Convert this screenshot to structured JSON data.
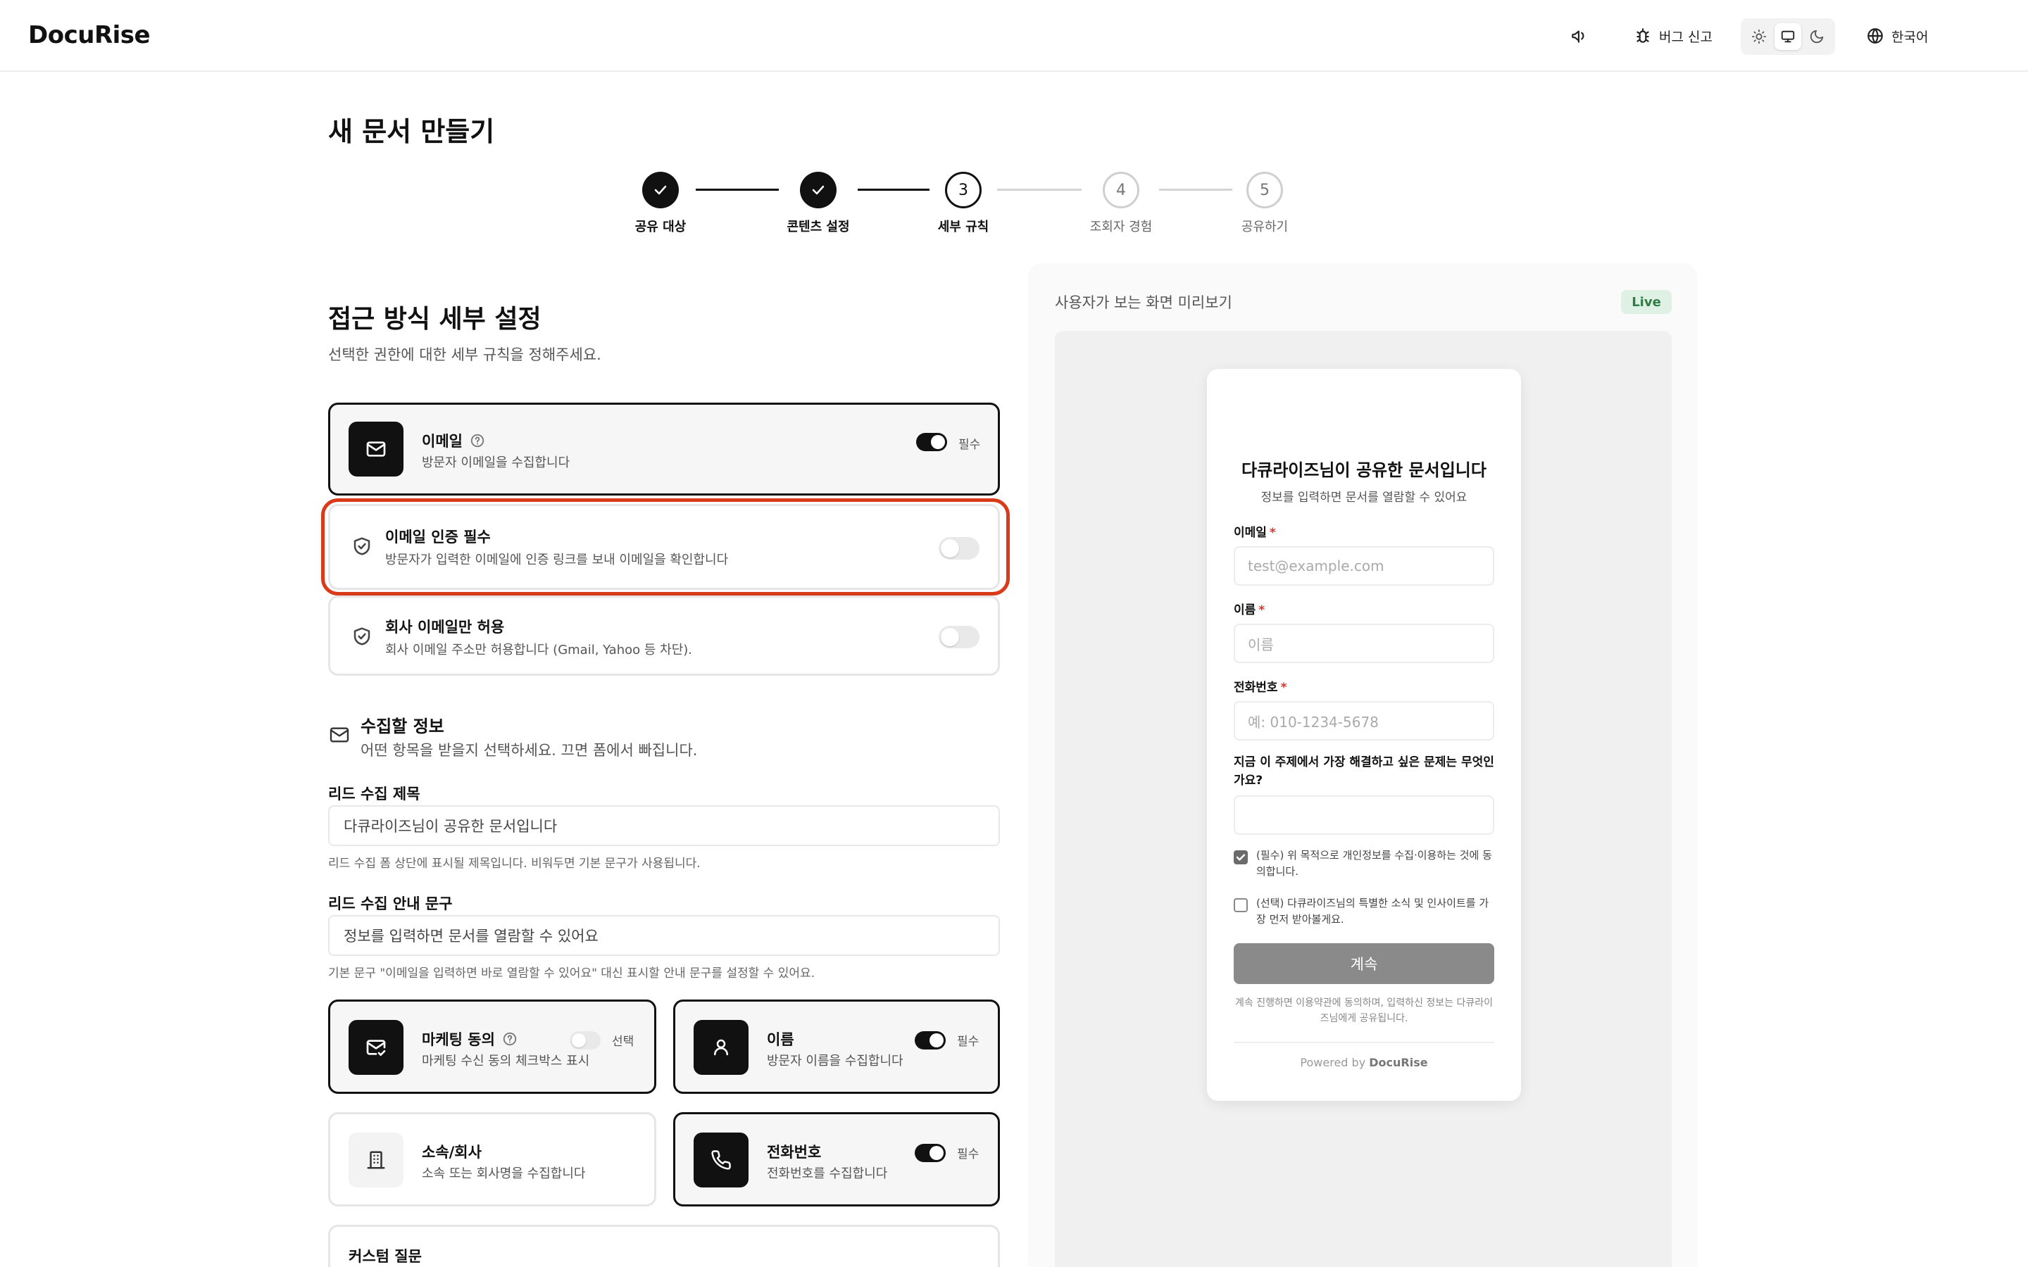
{
  "header": {
    "logo": "DocuRise",
    "bug_report_label": "버그 신고",
    "language_label": "한국어"
  },
  "page": {
    "title": "새 문서 만들기"
  },
  "stepper": {
    "steps": [
      {
        "number": "",
        "label": "공유 대상",
        "state": "done"
      },
      {
        "number": "",
        "label": "콘텐츠 설정",
        "state": "done"
      },
      {
        "number": "3",
        "label": "세부 규칙",
        "state": "current"
      },
      {
        "number": "4",
        "label": "조회자 경험",
        "state": "todo"
      },
      {
        "number": "5",
        "label": "공유하기",
        "state": "todo"
      }
    ]
  },
  "access": {
    "title": "접근 방식 세부 설정",
    "subtitle": "선택한 권한에 대한 세부 규칙을 정해주세요.",
    "email_card": {
      "title": "이메일",
      "desc": "방문자 이메일을 수집합니다",
      "toggle": true,
      "tag": "필수"
    },
    "email_verify": {
      "title": "이메일 인증 필수",
      "desc": "방문자가 입력한 이메일에 인증 링크를 보내 이메일을 확인합니다",
      "toggle": false
    },
    "company_only": {
      "title": "회사 이메일만 허용",
      "desc": "회사 이메일 주소만 허용합니다 (Gmail, Yahoo 등 차단).",
      "toggle": false
    }
  },
  "collect": {
    "title": "수집할 정보",
    "subtitle": "어떤 항목을 받을지 선택하세요. 끄면 폼에서 빠집니다.",
    "lead_title_label": "리드 수집 제목",
    "lead_title_value": "다큐라이즈님이 공유한 문서입니다",
    "lead_title_hint": "리드 수집 폼 상단에 표시될 제목입니다. 비워두면 기본 문구가 사용됩니다.",
    "lead_guide_label": "리드 수집 안내 문구",
    "lead_guide_value": "정보를 입력하면 문서를 열람할 수 있어요",
    "lead_guide_hint": "기본 문구 \"이메일을 입력하면 바로 열람할 수 있어요\" 대신 표시할 안내 문구를 설정할 수 있어요.",
    "fields": {
      "marketing": {
        "title": "마케팅 동의",
        "desc": "마케팅 수신 동의 체크박스 표시",
        "tag": "선택",
        "toggle": false
      },
      "name": {
        "title": "이름",
        "desc": "방문자 이름을 수집합니다",
        "tag": "필수",
        "toggle": true
      },
      "company": {
        "title": "소속/회사",
        "desc": "소속 또는 회사명을 수집합니다"
      },
      "phone": {
        "title": "전화번호",
        "desc": "전화번호를 수집합니다",
        "tag": "필수",
        "toggle": true
      }
    },
    "custom_question_title": "커스텀 질문"
  },
  "preview": {
    "header": "사용자가 보는 화면 미리보기",
    "live_badge": "Live",
    "title": "다큐라이즈님이 공유한 문서입니다",
    "subtitle": "정보를 입력하면 문서를 열람할 수 있어요",
    "required_mark": "*",
    "email_label": "이메일",
    "email_placeholder": "test@example.com",
    "name_label": "이름",
    "name_placeholder": "이름",
    "phone_label": "전화번호",
    "phone_placeholder": "예: 010-1234-5678",
    "question": "지금 이 주제에서 가장 해결하고 싶은 문제는 무엇인가요?",
    "consent_required": "(필수) 위 목적으로 개인정보를 수집·이용하는 것에 동의합니다.",
    "consent_optional": "(선택) 다큐라이즈님의 특별한 소식 및 인사이트를 가장 먼저 받아볼게요.",
    "continue_button": "계속",
    "footnote": "계속 진행하면 이용약관에 동의하며, 입력하신 정보는 다큐라이즈님에게 공유됩니다.",
    "powered_prefix": "Powered by",
    "powered_brand": "DocuRise"
  }
}
